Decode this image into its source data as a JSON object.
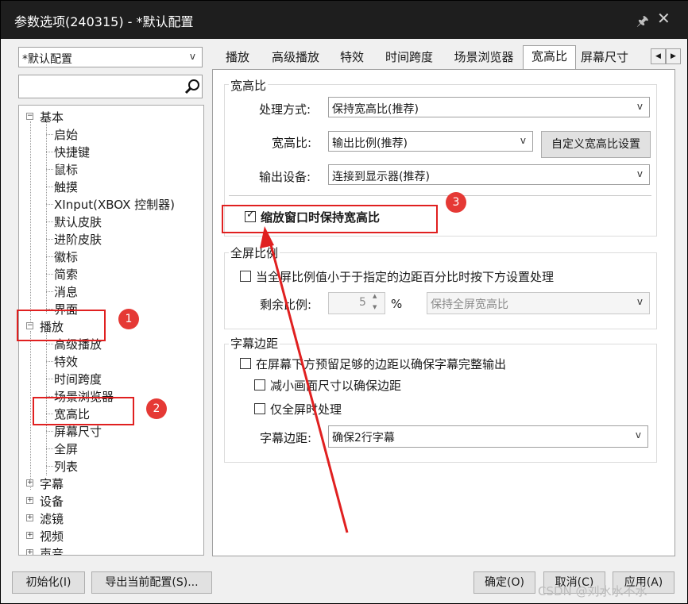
{
  "window": {
    "title": "参数选项(240315) - *默认配置"
  },
  "config_select": {
    "value": "*默认配置"
  },
  "search": {
    "placeholder": ""
  },
  "tree": {
    "basic": {
      "label": "基本",
      "children": [
        "启始",
        "快捷键",
        "鼠标",
        "触摸",
        "XInput(XBOX 控制器)",
        "默认皮肤",
        "进阶皮肤",
        "徽标",
        "简索",
        "消息",
        "界面"
      ]
    },
    "playback": {
      "label": "播放",
      "children": [
        "高级播放",
        "特效",
        "时间跨度",
        "场景浏览器",
        "宽高比",
        "屏幕尺寸",
        "全屏",
        "列表"
      ]
    },
    "collapsed": [
      "字幕",
      "设备",
      "滤镜",
      "视频",
      "声音"
    ]
  },
  "tabs": [
    "播放",
    "高级播放",
    "特效",
    "时间跨度",
    "场景浏览器",
    "宽高比",
    "屏幕尺寸"
  ],
  "active_tab": "宽高比",
  "aspect_group": {
    "title": "宽高比",
    "method_label": "处理方式:",
    "method_value": "保持宽高比(推荐)",
    "ratio_label": "宽高比:",
    "ratio_value": "输出比例(推荐)",
    "custom_button": "自定义宽高比设置",
    "device_label": "输出设备:",
    "device_value": "连接到显示器(推荐)",
    "keep_on_resize": "缩放窗口时保持宽高比",
    "keep_on_resize_checked": true
  },
  "fullscreen_group": {
    "title": "全屏比例",
    "condition": "当全屏比例值小于于指定的边距百分比时按下方设置处理",
    "remain_label": "剩余比例:",
    "remain_value": "5",
    "unit": "%",
    "mode_value": "保持全屏宽高比"
  },
  "subtitle_group": {
    "title": "字幕边距",
    "reserve": "在屏幕下方预留足够的边距以确保字幕完整输出",
    "shrink": "减小画面尺寸以确保边距",
    "fullscreen_only": "仅全屏时处理",
    "margin_label": "字幕边距:",
    "margin_value": "确保2行字幕"
  },
  "footer": {
    "reset": "初始化(I)",
    "export": "导出当前配置(S)...",
    "ok": "确定(O)",
    "cancel": "取消(C)",
    "apply": "应用(A)"
  },
  "annotations": {
    "badge1": "1",
    "badge2": "2",
    "badge3": "3",
    "color": "#e02020"
  },
  "watermark": "CSDN @刘水水不水"
}
